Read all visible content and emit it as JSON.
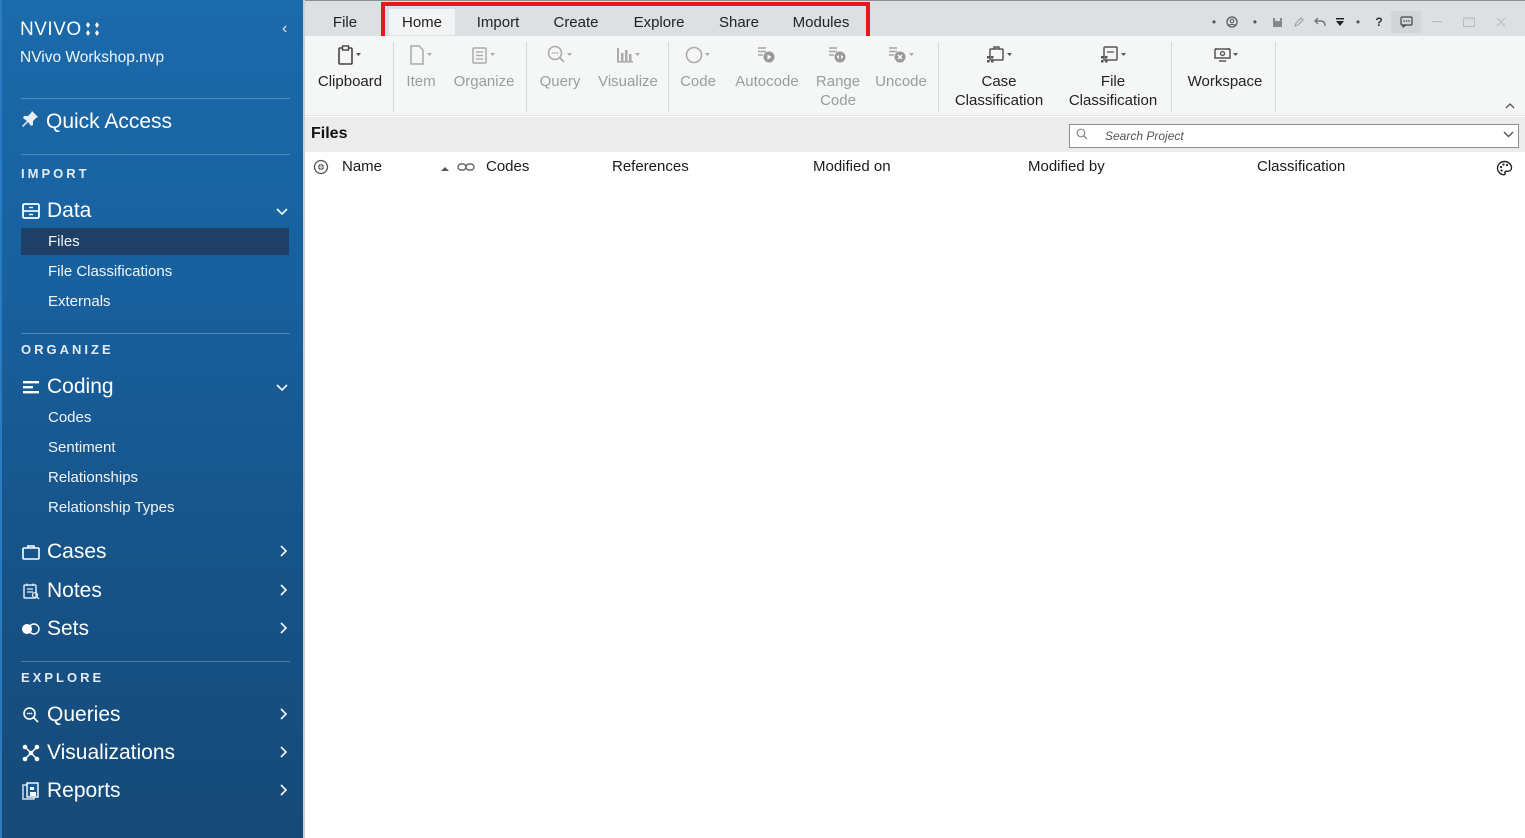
{
  "sidebar": {
    "logo": "NVIVO",
    "logo_mark": "⁘",
    "project_name": "NVivo Workshop.nvp",
    "quick_access": "Quick Access",
    "sections": {
      "import": "IMPORT",
      "organize": "ORGANIZE",
      "explore": "EXPLORE"
    },
    "groups": {
      "data": {
        "label": "Data",
        "expanded": true,
        "items": [
          "Files",
          "File Classifications",
          "Externals"
        ],
        "active": "Files"
      },
      "coding": {
        "label": "Coding",
        "expanded": true,
        "items": [
          "Codes",
          "Sentiment",
          "Relationships",
          "Relationship Types"
        ]
      },
      "cases": {
        "label": "Cases",
        "expanded": false
      },
      "notes": {
        "label": "Notes",
        "expanded": false
      },
      "sets": {
        "label": "Sets",
        "expanded": false
      },
      "queries": {
        "label": "Queries",
        "expanded": false
      },
      "visualizations": {
        "label": "Visualizations",
        "expanded": false
      },
      "reports": {
        "label": "Reports",
        "expanded": false
      }
    }
  },
  "menu": {
    "tabs": [
      "File",
      "Home",
      "Import",
      "Create",
      "Explore",
      "Share",
      "Modules"
    ],
    "active": "Home",
    "highlight_color": "#e5181f"
  },
  "ribbon": {
    "buttons": [
      {
        "label": "Clipboard",
        "enabled": true
      },
      {
        "label": "Item",
        "enabled": false
      },
      {
        "label": "Organize",
        "enabled": false
      },
      {
        "label": "Query",
        "enabled": false
      },
      {
        "label": "Visualize",
        "enabled": false
      },
      {
        "label": "Code",
        "enabled": false
      },
      {
        "label": "Autocode",
        "enabled": false
      },
      {
        "label": "Range Code",
        "enabled": false
      },
      {
        "label": "Uncode",
        "enabled": false
      },
      {
        "label": "Case Classification",
        "enabled": true
      },
      {
        "label": "File Classification",
        "enabled": true
      },
      {
        "label": "Workspace",
        "enabled": true
      }
    ],
    "range_code_lines": [
      "Range",
      "Code"
    ],
    "case_class_lines": [
      "Case",
      "Classification"
    ],
    "file_class_lines": [
      "File",
      "Classification"
    ]
  },
  "content": {
    "title": "Files",
    "search_placeholder": "Search Project",
    "columns": [
      "Name",
      "Codes",
      "References",
      "Modified on",
      "Modified by",
      "Classification"
    ]
  },
  "colors": {
    "sidebar_top": "#1b6aaa",
    "sidebar_bottom": "#164a78",
    "active_item": "#1e3f66"
  }
}
